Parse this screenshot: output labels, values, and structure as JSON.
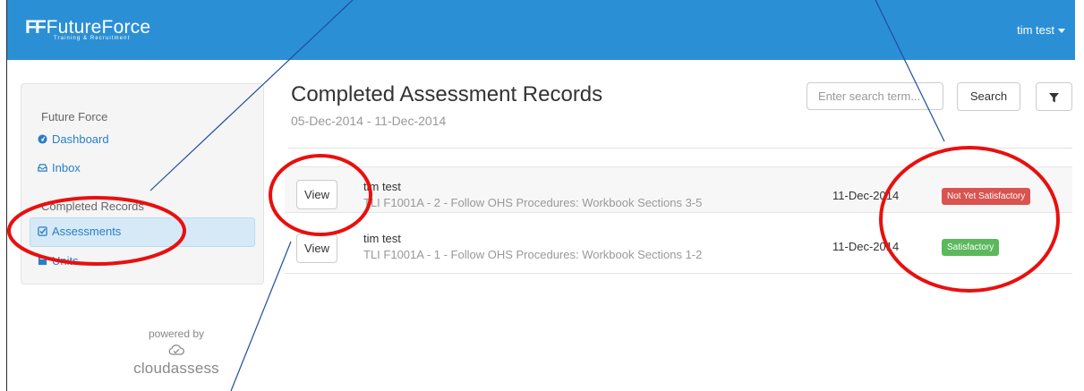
{
  "brand": {
    "mark": "FF",
    "name": "FutureForce",
    "tagline": "Training & Recruitment"
  },
  "user_menu": {
    "label": "tim test"
  },
  "sidebar": {
    "section1": "Future Force",
    "items1": [
      {
        "label": "Dashboard",
        "icon": "dashboard-icon"
      },
      {
        "label": "Inbox",
        "icon": "inbox-icon"
      }
    ],
    "section2": "Completed Records",
    "items2": [
      {
        "label": "Assessments",
        "icon": "checkbox-icon",
        "active": true
      },
      {
        "label": "Units",
        "icon": "book-icon"
      }
    ]
  },
  "powered": {
    "line1": "powered by",
    "brand": "cloudassess"
  },
  "main": {
    "title": "Completed Assessment Records",
    "date_range": "05-Dec-2014 - 11-Dec-2014",
    "search": {
      "placeholder": "Enter search term...",
      "button": "Search"
    },
    "filter_icon": "filter-icon"
  },
  "records": [
    {
      "view_label": "View",
      "name": "tim test",
      "description": "TLI F1001A - 2 - Follow OHS Procedures: Workbook Sections 3-5",
      "date": "11-Dec-2014",
      "status": "Not Yet Satisfactory",
      "status_color": "#d9534f"
    },
    {
      "view_label": "View",
      "name": "tim test",
      "description": "TLI F1001A - 1 - Follow OHS Procedures: Workbook Sections 1-2",
      "date": "11-Dec-2014",
      "status": "Satisfactory",
      "status_color": "#5cb85c"
    }
  ],
  "colors": {
    "navbar": "#2b8fd6",
    "link": "#2a7fc6",
    "annotation_ring": "#e8100f",
    "annotation_line": "#1f4e9c"
  }
}
